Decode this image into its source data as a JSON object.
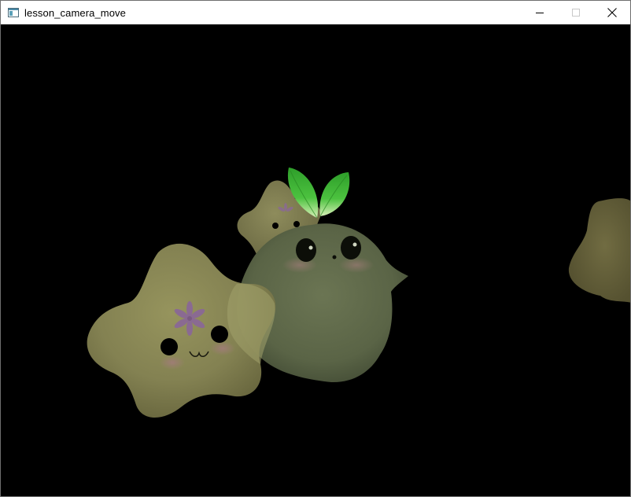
{
  "window": {
    "title": "lesson_camera_move",
    "icon": "app-window-icon",
    "controls": {
      "minimize_icon": "minimize-icon",
      "maximize_icon": "maximize-icon",
      "close_icon": "close-icon"
    }
  },
  "viewport": {
    "background": "#000000",
    "objects": [
      {
        "name": "yellow-star-creature",
        "color": "#8a8a55"
      },
      {
        "name": "small-star-creature",
        "color": "#7d7c52"
      },
      {
        "name": "sprout-blob-creature",
        "color": "#5d6646"
      },
      {
        "name": "partial-star-creature",
        "color": "#66613a"
      }
    ],
    "accents": {
      "leaf": "#37b233",
      "flower": "#8a6a92",
      "blush": "#9a7f74",
      "eyes": "#000000"
    }
  }
}
